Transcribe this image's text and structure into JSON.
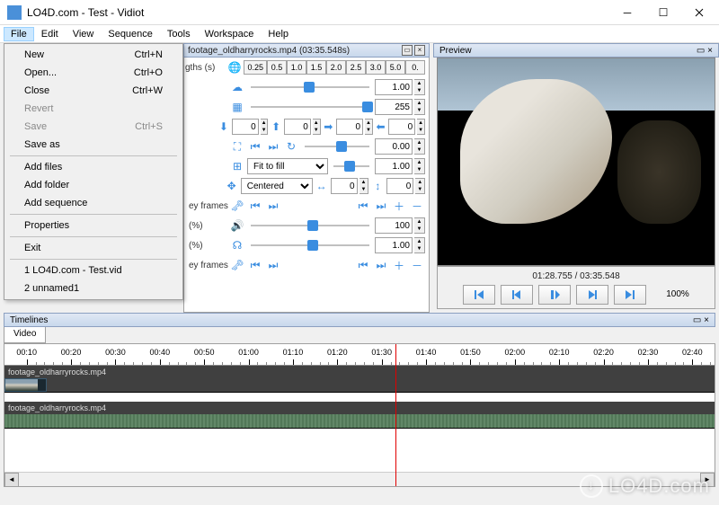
{
  "window": {
    "title": "LO4D.com - Test - Vidiot"
  },
  "menubar": [
    "File",
    "Edit",
    "View",
    "Sequence",
    "Tools",
    "Workspace",
    "Help"
  ],
  "file_menu": {
    "items": [
      {
        "label": "New",
        "shortcut": "Ctrl+N",
        "enabled": true
      },
      {
        "label": "Open...",
        "shortcut": "Ctrl+O",
        "enabled": true
      },
      {
        "label": "Close",
        "shortcut": "Ctrl+W",
        "enabled": true
      },
      {
        "label": "Revert",
        "shortcut": "",
        "enabled": false
      },
      {
        "label": "Save",
        "shortcut": "Ctrl+S",
        "enabled": false
      },
      {
        "label": "Save as",
        "shortcut": "",
        "enabled": true
      }
    ],
    "items2": [
      {
        "label": "Add files",
        "enabled": true
      },
      {
        "label": "Add folder",
        "enabled": true
      },
      {
        "label": "Add sequence",
        "enabled": true
      }
    ],
    "items3": [
      {
        "label": "Properties",
        "enabled": true
      }
    ],
    "items4": [
      {
        "label": "Exit",
        "enabled": true
      }
    ],
    "items5": [
      {
        "label": "1 LO4D.com - Test.vid",
        "enabled": true
      },
      {
        "label": "2 unnamed1",
        "enabled": true
      }
    ]
  },
  "details": {
    "title": "footage_oldharryrocks.mp4 (03:35.548s)",
    "lengths_label": "gths (s)",
    "speed_buttons": [
      "0.25",
      "0.5",
      "1.0",
      "1.5",
      "2.0",
      "2.5",
      "3.0",
      "5.0",
      "0."
    ],
    "speed_value": "1.00",
    "opacity_value": "255",
    "crop_left": "0",
    "crop_top": "0",
    "crop_right": "0",
    "crop_bottom": "0",
    "position_value": "0.00",
    "scaling_mode": "Fit to fill",
    "alignment_mode": "Centered",
    "pos_x": "0",
    "pos_y": "0",
    "volume_value": "100",
    "pan_value": "1.00",
    "keyframes_label": "ey frames",
    "percent_label": "(%)"
  },
  "preview": {
    "title": "Preview",
    "time": "01:28.755 / 03:35.548",
    "zoom": "100%"
  },
  "timelines": {
    "title": "Timelines",
    "tab": "Video",
    "ruler_ticks": [
      "00:10",
      "00:20",
      "00:30",
      "00:40",
      "00:50",
      "01:00",
      "01:10",
      "01:20",
      "01:30",
      "01:40",
      "01:50",
      "02:00",
      "02:10",
      "02:20",
      "02:30",
      "02:40"
    ],
    "clip1": "footage_oldharryrocks.mp4",
    "clip2": "footage_oldharryrocks.mp4",
    "playhead_pct": 55
  },
  "watermark": "LO4D.com"
}
